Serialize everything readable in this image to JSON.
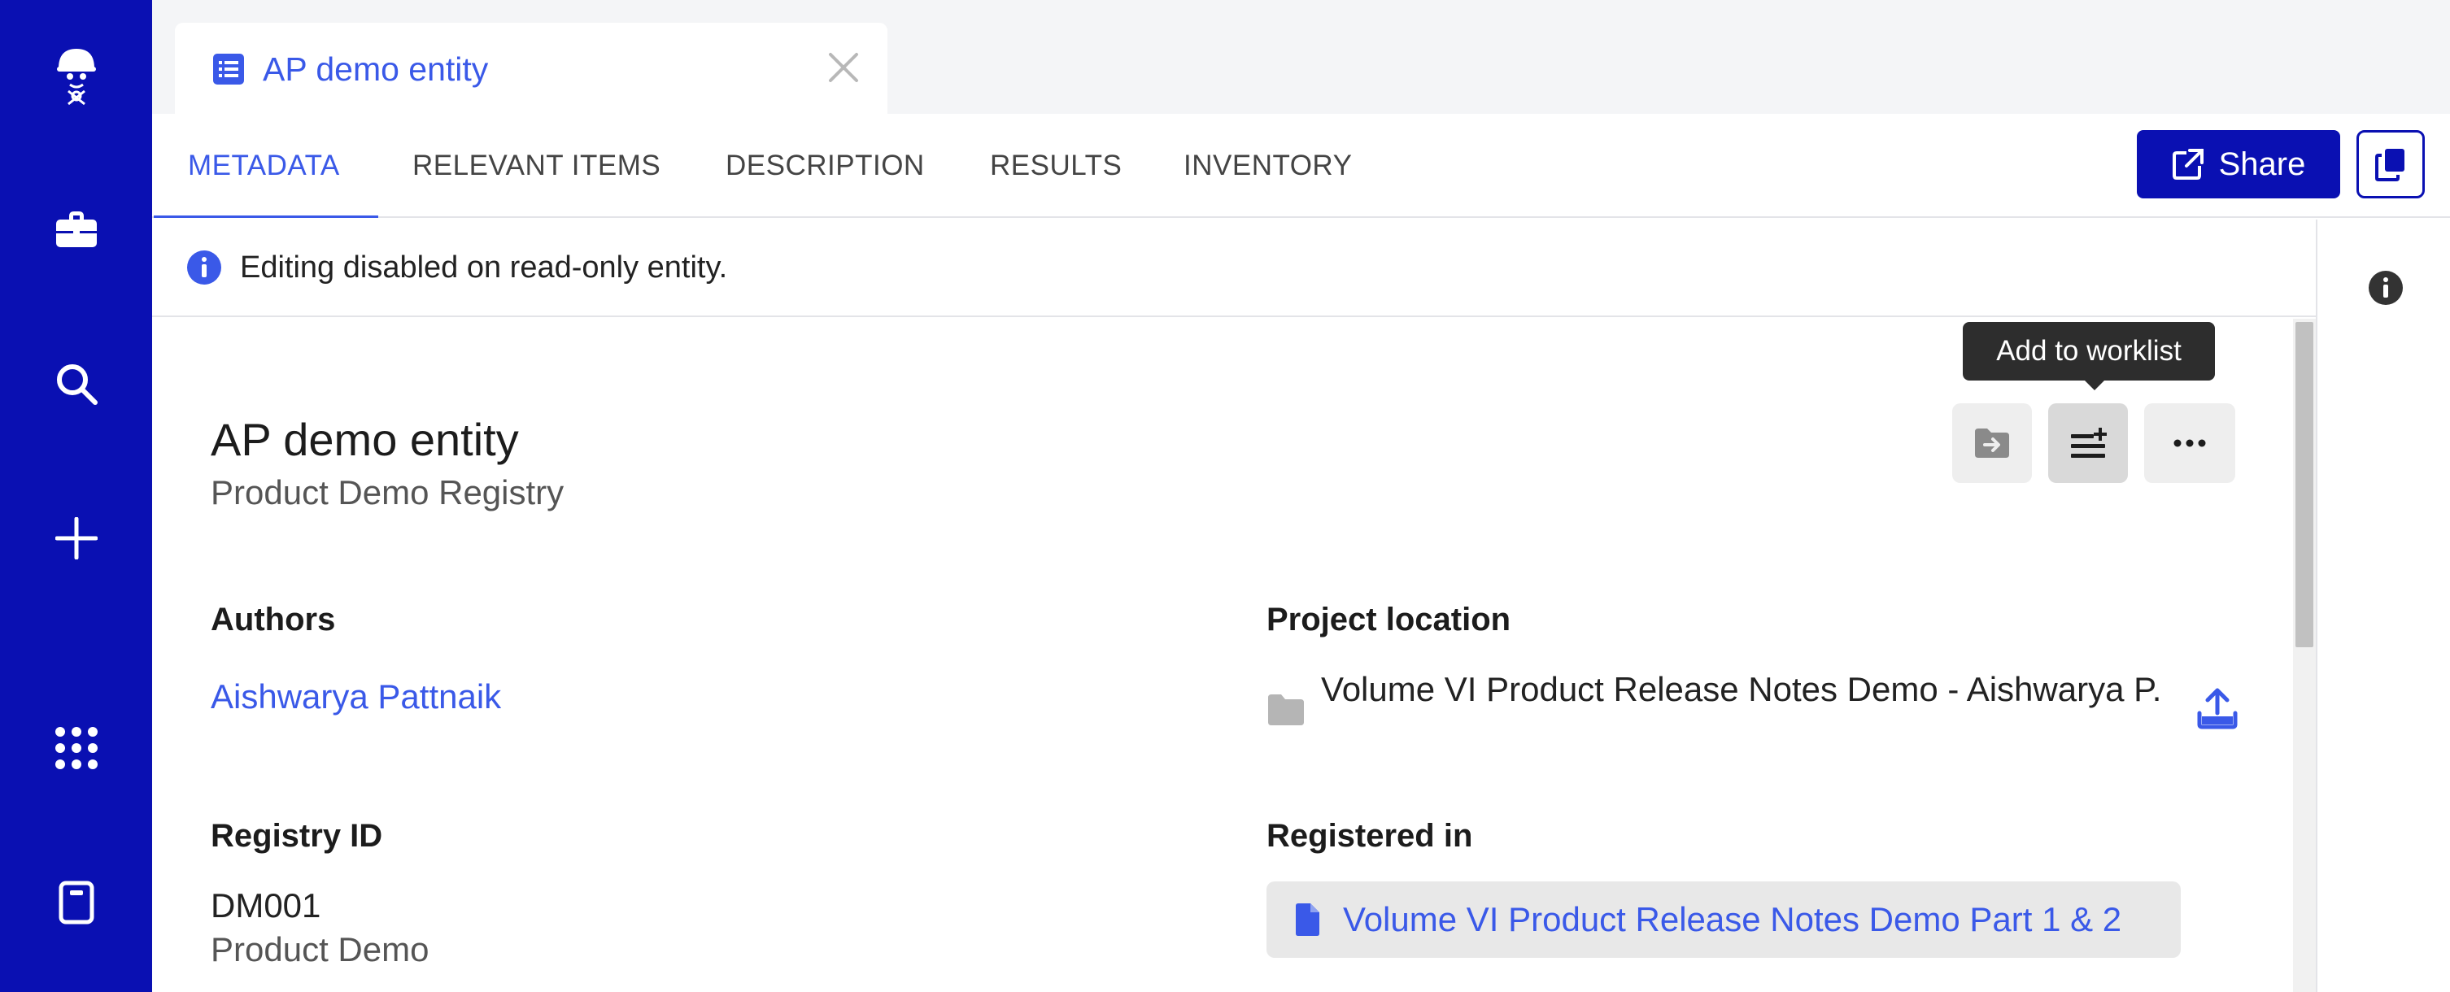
{
  "tab": {
    "title": "AP demo entity"
  },
  "subnav": {
    "tabs": [
      "METADATA",
      "RELEVANT ITEMS",
      "DESCRIPTION",
      "RESULTS",
      "INVENTORY"
    ],
    "active": "METADATA",
    "share_label": "Share"
  },
  "notice": {
    "text": "Editing disabled on read-only entity."
  },
  "entity": {
    "title": "AP demo entity",
    "subtitle": "Product Demo Registry"
  },
  "tooltip": {
    "text": "Add to worklist"
  },
  "fields": {
    "authors_label": "Authors",
    "authors_value": "Aishwarya Pattnaik",
    "project_label": "Project location",
    "project_value": "Volume VI Product Release Notes Demo - Aishwarya P.",
    "registry_label": "Registry ID",
    "registry_value": "DM001",
    "registry_sub": "Product Demo",
    "registered_label": "Registered in",
    "registered_value": "Volume VI Product Release Notes Demo Part 1 & 2"
  },
  "colors": {
    "rail": "#0a10b2",
    "accent": "#3a59e8",
    "tooltip_bg": "#2d2d2d"
  },
  "icons": {
    "rail": [
      "scientist-logo-icon",
      "briefcase-icon",
      "search-icon",
      "plus-icon",
      "apps-grid-icon",
      "notebook-icon"
    ],
    "actions": [
      "move-to-folder-icon",
      "add-to-worklist-icon",
      "more-icon"
    ]
  }
}
